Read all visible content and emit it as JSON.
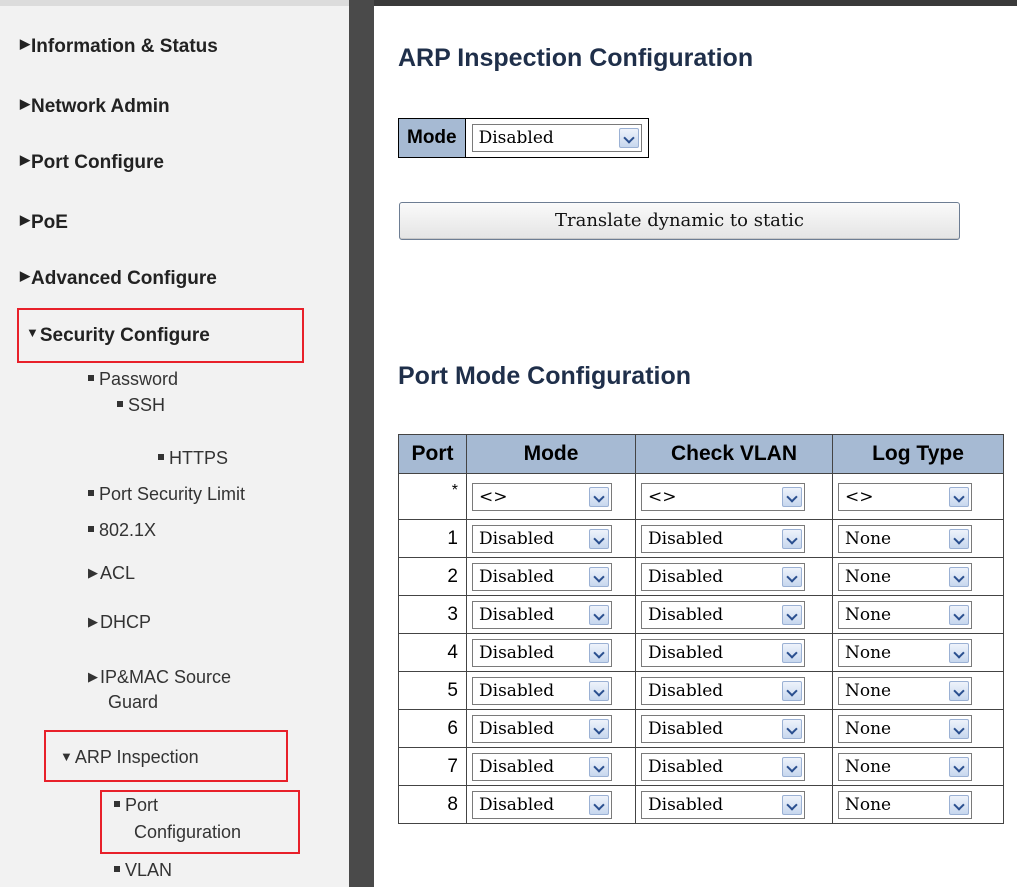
{
  "sidebar": {
    "top_items": [
      {
        "label": "Information & Status"
      },
      {
        "label": "Network Admin"
      },
      {
        "label": "Port Configure"
      },
      {
        "label": "PoE"
      },
      {
        "label": "Advanced Configure"
      },
      {
        "label": "Security Configure"
      }
    ],
    "sub_items": [
      {
        "label": "Password"
      },
      {
        "label": "SSH"
      },
      {
        "label": "HTTPS"
      },
      {
        "label": "Port Security Limit"
      },
      {
        "label": "802.1X"
      },
      {
        "label": "ACL"
      },
      {
        "label": "DHCP"
      },
      {
        "label": "IP&MAC Source"
      },
      {
        "label": "Guard"
      },
      {
        "label": "ARP Inspection"
      },
      {
        "label": "Port"
      },
      {
        "label": "Configuration"
      },
      {
        "label": "VLAN"
      }
    ]
  },
  "main": {
    "arp_title": "ARP Inspection Configuration",
    "mode_label": "Mode",
    "mode_value": "Disabled",
    "translate_button": "Translate dynamic to static",
    "port_title": "Port Mode Configuration",
    "table": {
      "headers": [
        "Port",
        "Mode",
        "Check VLAN",
        "Log Type"
      ],
      "rows": [
        {
          "port": "*",
          "mode": "<>",
          "check_vlan": "<>",
          "log_type": "<>"
        },
        {
          "port": "1",
          "mode": "Disabled",
          "check_vlan": "Disabled",
          "log_type": "None"
        },
        {
          "port": "2",
          "mode": "Disabled",
          "check_vlan": "Disabled",
          "log_type": "None"
        },
        {
          "port": "3",
          "mode": "Disabled",
          "check_vlan": "Disabled",
          "log_type": "None"
        },
        {
          "port": "4",
          "mode": "Disabled",
          "check_vlan": "Disabled",
          "log_type": "None"
        },
        {
          "port": "5",
          "mode": "Disabled",
          "check_vlan": "Disabled",
          "log_type": "None"
        },
        {
          "port": "6",
          "mode": "Disabled",
          "check_vlan": "Disabled",
          "log_type": "None"
        },
        {
          "port": "7",
          "mode": "Disabled",
          "check_vlan": "Disabled",
          "log_type": "None"
        },
        {
          "port": "8",
          "mode": "Disabled",
          "check_vlan": "Disabled",
          "log_type": "None"
        }
      ]
    }
  },
  "colors": {
    "header_bg": "#a6bad3",
    "highlight": "#e8202a",
    "divider": "#4a4a4a",
    "title": "#1f2f4a"
  }
}
